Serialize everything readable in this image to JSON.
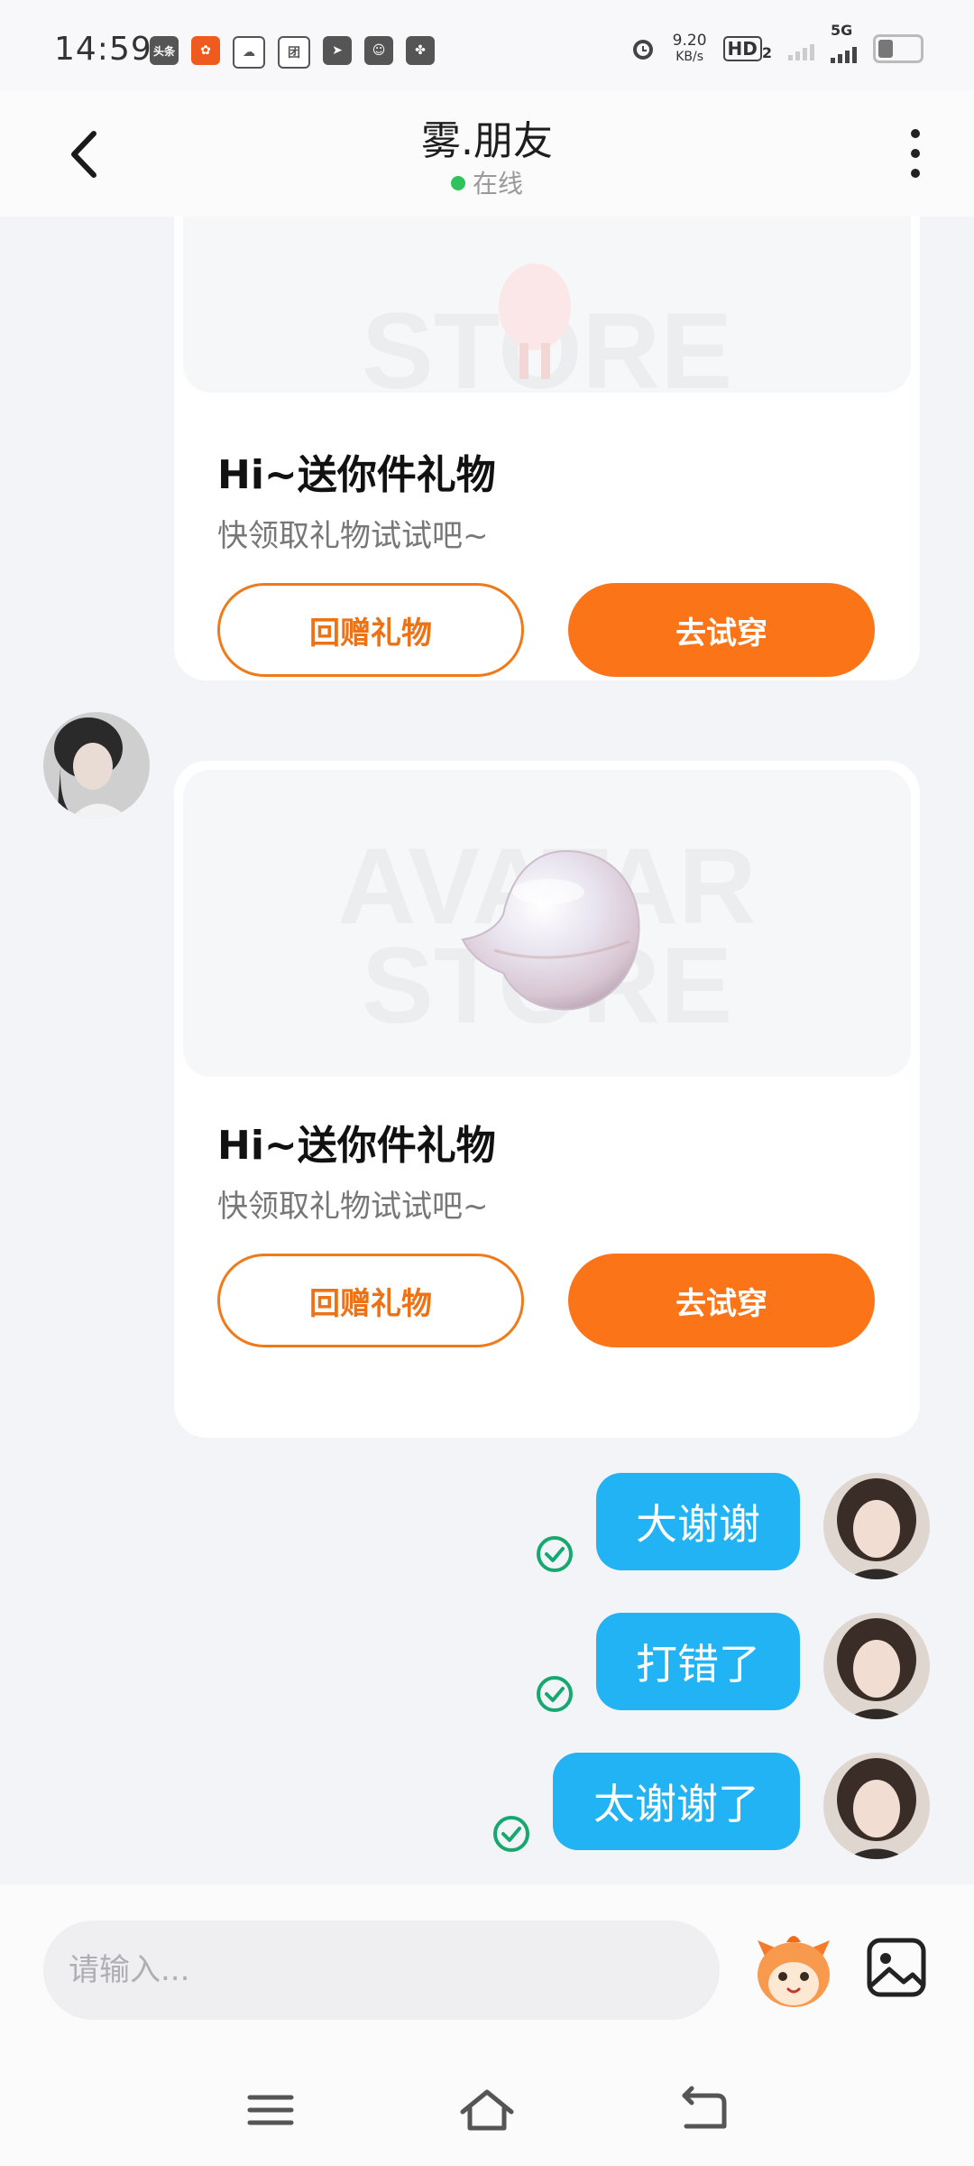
{
  "status_bar": {
    "time": "14:59",
    "speed_value": "9.20",
    "speed_unit": "KB/s",
    "hd_label": "HD",
    "hd_sub": "2",
    "network": "5G",
    "app_icons": [
      "头条",
      "淘宝",
      "云",
      "团",
      "飞书",
      "微信",
      "风车"
    ]
  },
  "header": {
    "back_icon": "chevron-left-icon",
    "title": "雾.朋友",
    "status": "在线",
    "status_color": "#2ec45a",
    "more_icon": "more-vertical-icon"
  },
  "messages": [
    {
      "type": "gift_card",
      "title": "Hi~送你件礼物",
      "subtitle": "快领取礼物试试吧~",
      "watermark": "STORE",
      "return_gift_label": "回赠礼物",
      "try_on_label": "去试穿"
    },
    {
      "type": "gift_card",
      "title": "Hi~送你件礼物",
      "subtitle": "快领取礼物试试吧~",
      "watermark_top": "AVATAR",
      "watermark": "STORE",
      "return_gift_label": "回赠礼物",
      "try_on_label": "去试穿"
    },
    {
      "type": "text",
      "from": "me",
      "text": "大谢谢",
      "delivered": true
    },
    {
      "type": "text",
      "from": "me",
      "text": "打错了",
      "delivered": true
    },
    {
      "type": "text",
      "from": "me",
      "text": "太谢谢了",
      "delivered": true
    }
  ],
  "input_bar": {
    "placeholder": "请输入...",
    "emoji_icon": "mascot-emoji-icon",
    "image_icon": "image-icon"
  },
  "nav_bar": {
    "menu_icon": "menu-icon",
    "home_icon": "home-icon",
    "back_icon": "back-icon"
  },
  "colors": {
    "accent": "#fc7418",
    "bubble": "#22b3f4",
    "check": "#16a86e"
  }
}
